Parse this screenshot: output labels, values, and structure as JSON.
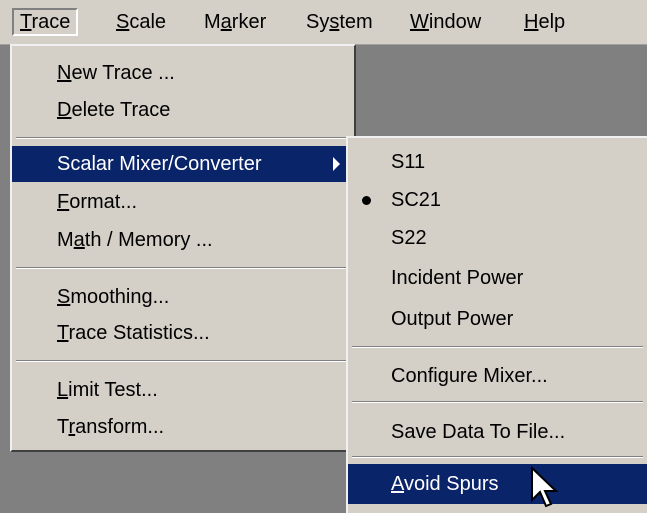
{
  "menubar": {
    "items": [
      {
        "pre": "",
        "mn": "T",
        "post": "race"
      },
      {
        "pre": "",
        "mn": "S",
        "post": "cale"
      },
      {
        "pre": "M",
        "mn": "a",
        "post": "rker"
      },
      {
        "pre": "Sy",
        "mn": "s",
        "post": "tem"
      },
      {
        "pre": "",
        "mn": "W",
        "post": "indow"
      },
      {
        "pre": "",
        "mn": "H",
        "post": "elp"
      }
    ]
  },
  "trace_menu": {
    "items": [
      {
        "pre": "",
        "mn": "N",
        "post": "ew Trace ..."
      },
      {
        "pre": "",
        "mn": "D",
        "post": "elete Trace"
      },
      {
        "pre": "",
        "mn": "",
        "post": "Scalar Mixer/Converter"
      },
      {
        "pre": "",
        "mn": "F",
        "post": "ormat..."
      },
      {
        "pre": "M",
        "mn": "a",
        "post": "th / Memory ..."
      },
      {
        "pre": "",
        "mn": "S",
        "post": "moothing..."
      },
      {
        "pre": "",
        "mn": "T",
        "post": "race Statistics..."
      },
      {
        "pre": "",
        "mn": "L",
        "post": "imit Test..."
      },
      {
        "pre": "T",
        "mn": "r",
        "post": "ansform..."
      }
    ]
  },
  "submenu": {
    "items": [
      {
        "pre": "",
        "mn": "",
        "post": "S11"
      },
      {
        "pre": "",
        "mn": "",
        "post": "SC21"
      },
      {
        "pre": "",
        "mn": "",
        "post": "S22"
      },
      {
        "pre": "",
        "mn": "",
        "post": "Incident Power"
      },
      {
        "pre": "",
        "mn": "",
        "post": "Output Power"
      },
      {
        "pre": "",
        "mn": "",
        "post": "Configure Mixer..."
      },
      {
        "pre": "",
        "mn": "",
        "post": "Save Data To File..."
      },
      {
        "pre": "",
        "mn": "A",
        "post": "void Spurs"
      }
    ]
  },
  "colors": {
    "highlight": "#0a246a",
    "menu_bg": "#d4d0c8",
    "workspace": "#808080"
  },
  "icons": {
    "submenu_arrow": "triangle-right",
    "checked": "bullet",
    "pointer": "arrow-cursor"
  }
}
